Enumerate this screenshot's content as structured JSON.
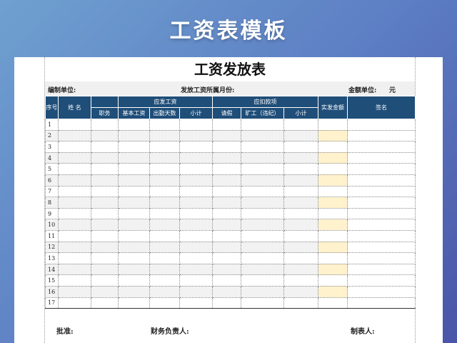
{
  "banner_title": "工资表模板",
  "sheet": {
    "title": "工资发放表",
    "unit_label": "编制单位:",
    "month_label": "发放工资所属月份:",
    "amount_unit_label": "金额单位:",
    "amount_unit_value": "元",
    "headers": {
      "seq": "序号",
      "name": "姓 名",
      "payable_group": "应发工资",
      "position": "职务",
      "base_salary": "基本工资",
      "attendance_days": "出勤天数",
      "subtotal1": "小计",
      "deduction_group": "应扣款项",
      "leave": "请假",
      "absence": "旷工（违纪）",
      "subtotal2": "小计",
      "net_amount": "实发金额",
      "signature": "签名"
    },
    "row_numbers": [
      "1",
      "2",
      "3",
      "4",
      "5",
      "6",
      "7",
      "8",
      "9",
      "10",
      "11",
      "12",
      "13",
      "14",
      "15",
      "16",
      "17"
    ],
    "footer": {
      "approve": "批准:",
      "finance_head": "财务负责人:",
      "preparer": "制表人:"
    },
    "colors": {
      "header_bg": "#1f4e79",
      "amount_col": "#fff2cc"
    }
  }
}
